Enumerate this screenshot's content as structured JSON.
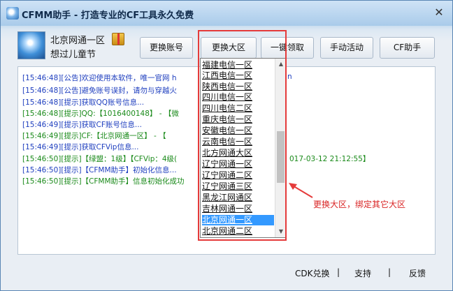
{
  "window": {
    "title": "CFMM助手 - 打造专业的CF工具永久免费",
    "close_glyph": "✕"
  },
  "profile": {
    "server": "北京网通一区",
    "nickname": "想过儿童节"
  },
  "toolbar": {
    "change_account": "更换账号",
    "change_region": "更换大区",
    "one_click_claim": "一键领取",
    "manual_activity": "手动活动",
    "cf_helper": "CF助手"
  },
  "log": [
    {
      "text": "[15:46:48][公告]欢迎使用本软件，唯一官网 h",
      "tail": "n",
      "color": "blue"
    },
    {
      "text": "[15:46:48][公告]避免账号误封，请勿与穿越火",
      "color": "blue"
    },
    {
      "text": "[15:46:48][提示]获取QQ账号信息...",
      "color": "blue"
    },
    {
      "text": "[15:46:48][提示]QQ:【1016400148】 - 【微",
      "color": "green"
    },
    {
      "text": "[15:46:49][提示]获取CF账号信息...",
      "color": "blue"
    },
    {
      "text": "[15:46:49][提示]CF:【北京网通一区】 - 【",
      "color": "green"
    },
    {
      "text": "[15:46:49][提示]获取CFVip信息...",
      "color": "blue"
    },
    {
      "text": "[15:46:50][提示]【绿盟：1级】【CFVip：4级(",
      "tail": "017-03-12 21:12:55】",
      "color": "green"
    },
    {
      "text": "[15:46:50][提示]【CFMM助手】初始化信息...",
      "color": "blue"
    },
    {
      "text": "[15:46:50][提示]【CFMM助手】信息初始化成功",
      "color": "green"
    }
  ],
  "region_dropdown": {
    "items": [
      "福建电信一区",
      "江西电信一区",
      "陕西电信一区",
      "四川电信一区",
      "四川电信二区",
      "重庆电信一区",
      "安徽电信一区",
      "云南电信一区",
      "北方网通大区",
      "辽宁网通一区",
      "辽宁网通二区",
      "辽宁网通三区",
      "黑龙江网通区",
      "吉林网通一区",
      "北京网通一区",
      "北京网通二区"
    ],
    "selected_index": 14,
    "scroll_up_glyph": "▲",
    "scroll_down_glyph": "▼"
  },
  "annotation": "更换大区，绑定其它大区",
  "footer": {
    "cdk_exchange": "CDK兑换",
    "support": "支持",
    "feedback": "反馈",
    "separator": "|"
  },
  "colors": {
    "log_blue": "#1f3fbf",
    "log_green": "#1a8a1a",
    "highlight_red": "#e53b3b",
    "selection_blue": "#3399ff"
  }
}
